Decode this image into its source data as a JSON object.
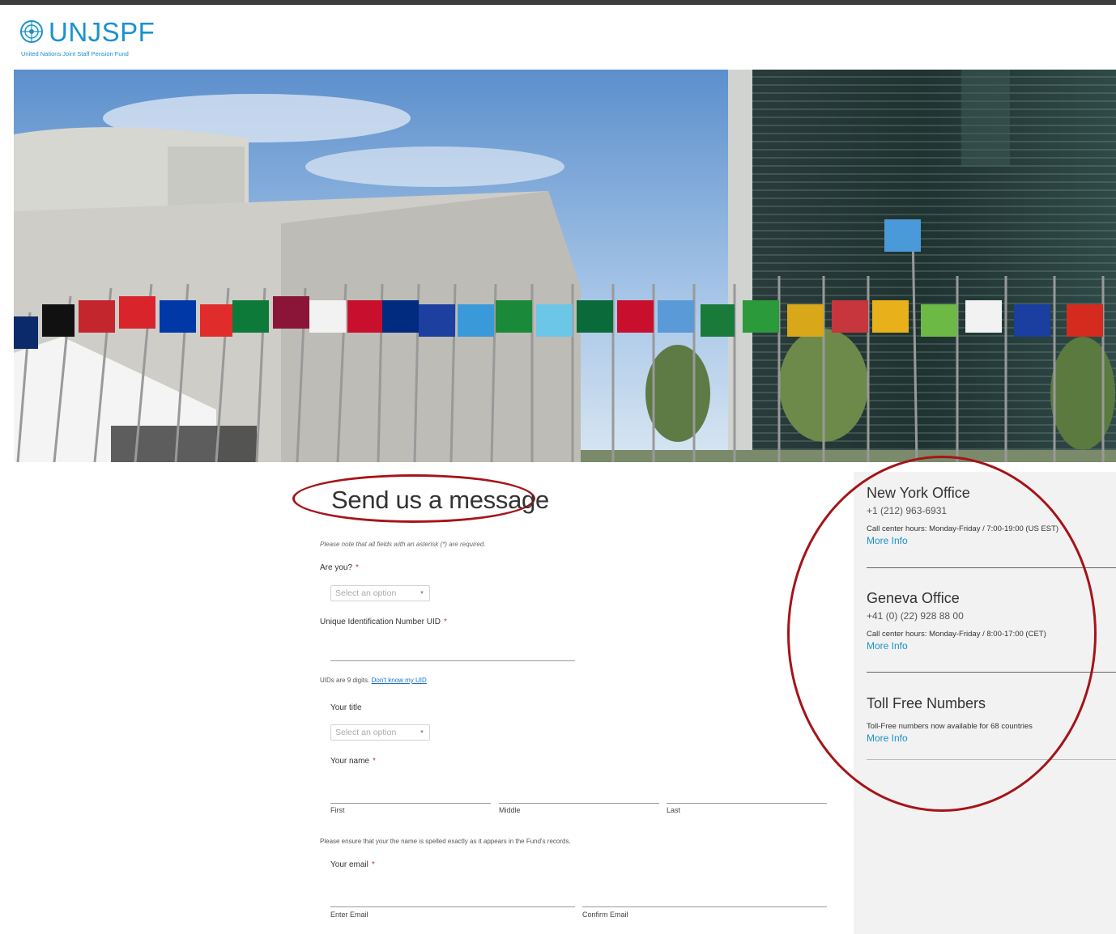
{
  "brand": {
    "name": "UNJSPF",
    "tagline": "United Nations Joint Staff Pension Fund",
    "color": "#1a92cf"
  },
  "form": {
    "title": "Send us a message",
    "required_note": "Please note that all fields with an asterisk (*) are required.",
    "are_you": {
      "label": "Are you?",
      "required": "*",
      "placeholder": "Select an option"
    },
    "uid": {
      "label": "Unique Identification Number UID",
      "required": "*",
      "help_text": "UIDs are 9 digits.",
      "help_link": "Don't know my UID"
    },
    "your_title": {
      "label": "Your title",
      "placeholder": "Select an option"
    },
    "your_name": {
      "label": "Your name",
      "required": "*",
      "first": "First",
      "middle": "Middle",
      "last": "Last",
      "note": "Please ensure that your the name is spelled exactly as it appears in the Fund's records."
    },
    "your_email": {
      "label": "Your email",
      "required": "*",
      "enter": "Enter Email",
      "confirm": "Confirm Email"
    }
  },
  "sidebar": {
    "offices": [
      {
        "name": "New York Office",
        "phone": "+1 (212) 963-6931",
        "hours": "Call center hours: Monday-Friday / 7:00-19:00 (US EST)",
        "more": "More Info"
      },
      {
        "name": "Geneva Office",
        "phone": "+41 (0) (22) 928 88 00",
        "hours": "Call center hours: Monday-Friday / 8:00-17:00 (CET)",
        "more": "More Info"
      },
      {
        "name": "Toll Free Numbers",
        "hours": "Toll-Free numbers now available for 68 countries",
        "more": "More Info"
      }
    ]
  },
  "colors": {
    "annotation_circle": "#a51418",
    "link": "#1a73c9",
    "required_asterisk": "#c0392b"
  }
}
